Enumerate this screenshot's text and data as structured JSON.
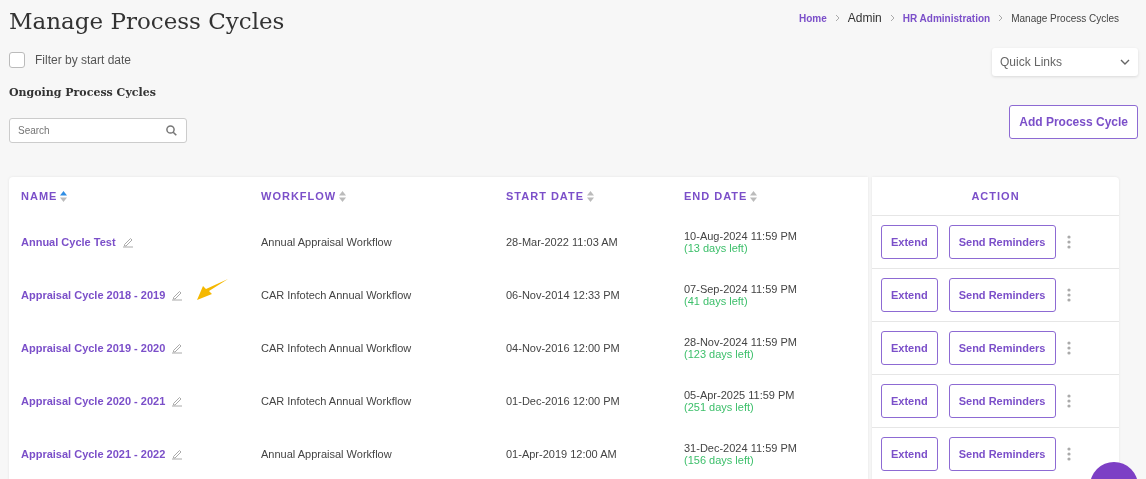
{
  "title": "Manage Process Cycles",
  "breadcrumb": [
    {
      "label": "Home",
      "link": true
    },
    {
      "label": "Admin",
      "link": false
    },
    {
      "label": "HR Administration",
      "link": true
    },
    {
      "label": "Manage Process Cycles",
      "link": false
    }
  ],
  "filter": {
    "label": "Filter by start date",
    "checked": false
  },
  "section_title": "Ongoing Process Cycles",
  "search": {
    "placeholder": "Search"
  },
  "quick_links": {
    "label": "Quick Links"
  },
  "add_button": "Add Process Cycle",
  "table": {
    "columns": [
      {
        "label": "NAME",
        "sorted": true
      },
      {
        "label": "WORKFLOW",
        "sorted": false
      },
      {
        "label": "START DATE",
        "sorted": false
      },
      {
        "label": "END DATE",
        "sorted": false
      }
    ],
    "action_header": "ACTION",
    "rows": [
      {
        "name": "Annual Cycle Test",
        "workflow": "Annual Appraisal Workflow",
        "start": "28-Mar-2022 11:03 AM",
        "end": "10-Aug-2024 11:59 PM",
        "remaining": "(13 days left)",
        "extend": "Extend",
        "remind": "Send Reminders",
        "pointer": false
      },
      {
        "name": "Appraisal Cycle 2018 - 2019",
        "workflow": "CAR Infotech Annual Workflow",
        "start": "06-Nov-2014 12:33 PM",
        "end": "07-Sep-2024 11:59 PM",
        "remaining": "(41 days left)",
        "extend": "Extend",
        "remind": "Send Reminders",
        "pointer": true
      },
      {
        "name": "Appraisal Cycle 2019 - 2020",
        "workflow": "CAR Infotech Annual Workflow",
        "start": "04-Nov-2016 12:00 PM",
        "end": "28-Nov-2024 11:59 PM",
        "remaining": "(123 days left)",
        "extend": "Extend",
        "remind": "Send Reminders",
        "pointer": false
      },
      {
        "name": "Appraisal Cycle 2020 - 2021",
        "workflow": "CAR Infotech Annual Workflow",
        "start": "01-Dec-2016 12:00 PM",
        "end": "05-Apr-2025 11:59 PM",
        "remaining": "(251 days left)",
        "extend": "Extend",
        "remind": "Send Reminders",
        "pointer": false
      },
      {
        "name": "Appraisal Cycle 2021 - 2022",
        "workflow": "Annual Appraisal Workflow",
        "start": "01-Apr-2019 12:00 AM",
        "end": "31-Dec-2024 11:59 PM",
        "remaining": "(156 days left)",
        "extend": "Extend",
        "remind": "Send Reminders",
        "pointer": false
      }
    ]
  }
}
